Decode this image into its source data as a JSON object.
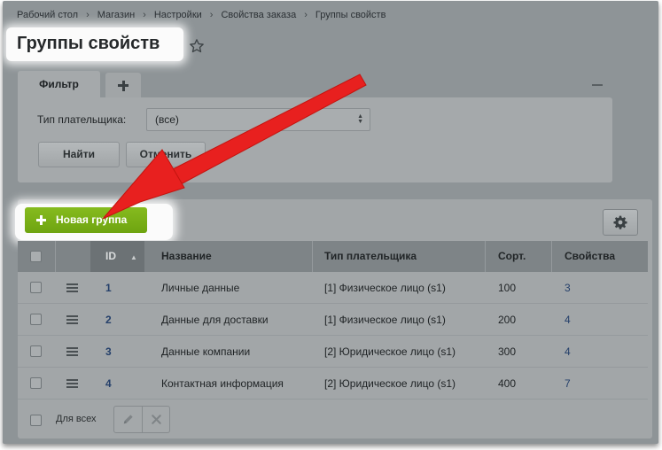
{
  "breadcrumbs": [
    "Рабочий стол",
    "Магазин",
    "Настройки",
    "Свойства заказа",
    "Группы свойств"
  ],
  "breadcrumb_separator": "›",
  "page_title": "Группы свойств",
  "filter": {
    "tab_label": "Фильтр",
    "payer_type_label": "Тип плательщика:",
    "payer_type_value": "(все)",
    "find_label": "Найти",
    "cancel_label": "Отменить"
  },
  "list": {
    "new_group_label": "Новая группа",
    "columns": {
      "id": "ID",
      "name": "Название",
      "payer_type": "Тип плательщика",
      "sort": "Сорт.",
      "properties": "Свойства"
    },
    "rows": [
      {
        "id": "1",
        "name": "Личные данные",
        "payer_type": "[1] Физическое лицо (s1)",
        "sort": "100",
        "properties": "3"
      },
      {
        "id": "2",
        "name": "Данные для доставки",
        "payer_type": "[1] Физическое лицо (s1)",
        "sort": "200",
        "properties": "4"
      },
      {
        "id": "3",
        "name": "Данные компании",
        "payer_type": "[2] Юридическое лицо (s1)",
        "sort": "300",
        "properties": "4"
      },
      {
        "id": "4",
        "name": "Контактная информация",
        "payer_type": "[2] Юридическое лицо (s1)",
        "sort": "400",
        "properties": "7"
      }
    ],
    "for_all_label": "Для всех"
  },
  "colors": {
    "accent_green": "#7ab317",
    "annotation_arrow": "#e8201f",
    "link": "#243f6a"
  },
  "icons": [
    "star-icon",
    "plus-icon",
    "minus-icon",
    "select-arrow-icon",
    "gear-icon",
    "sort-asc-icon",
    "drag-handle-icon",
    "pencil-icon",
    "close-icon",
    "red-arrow-annotation"
  ]
}
